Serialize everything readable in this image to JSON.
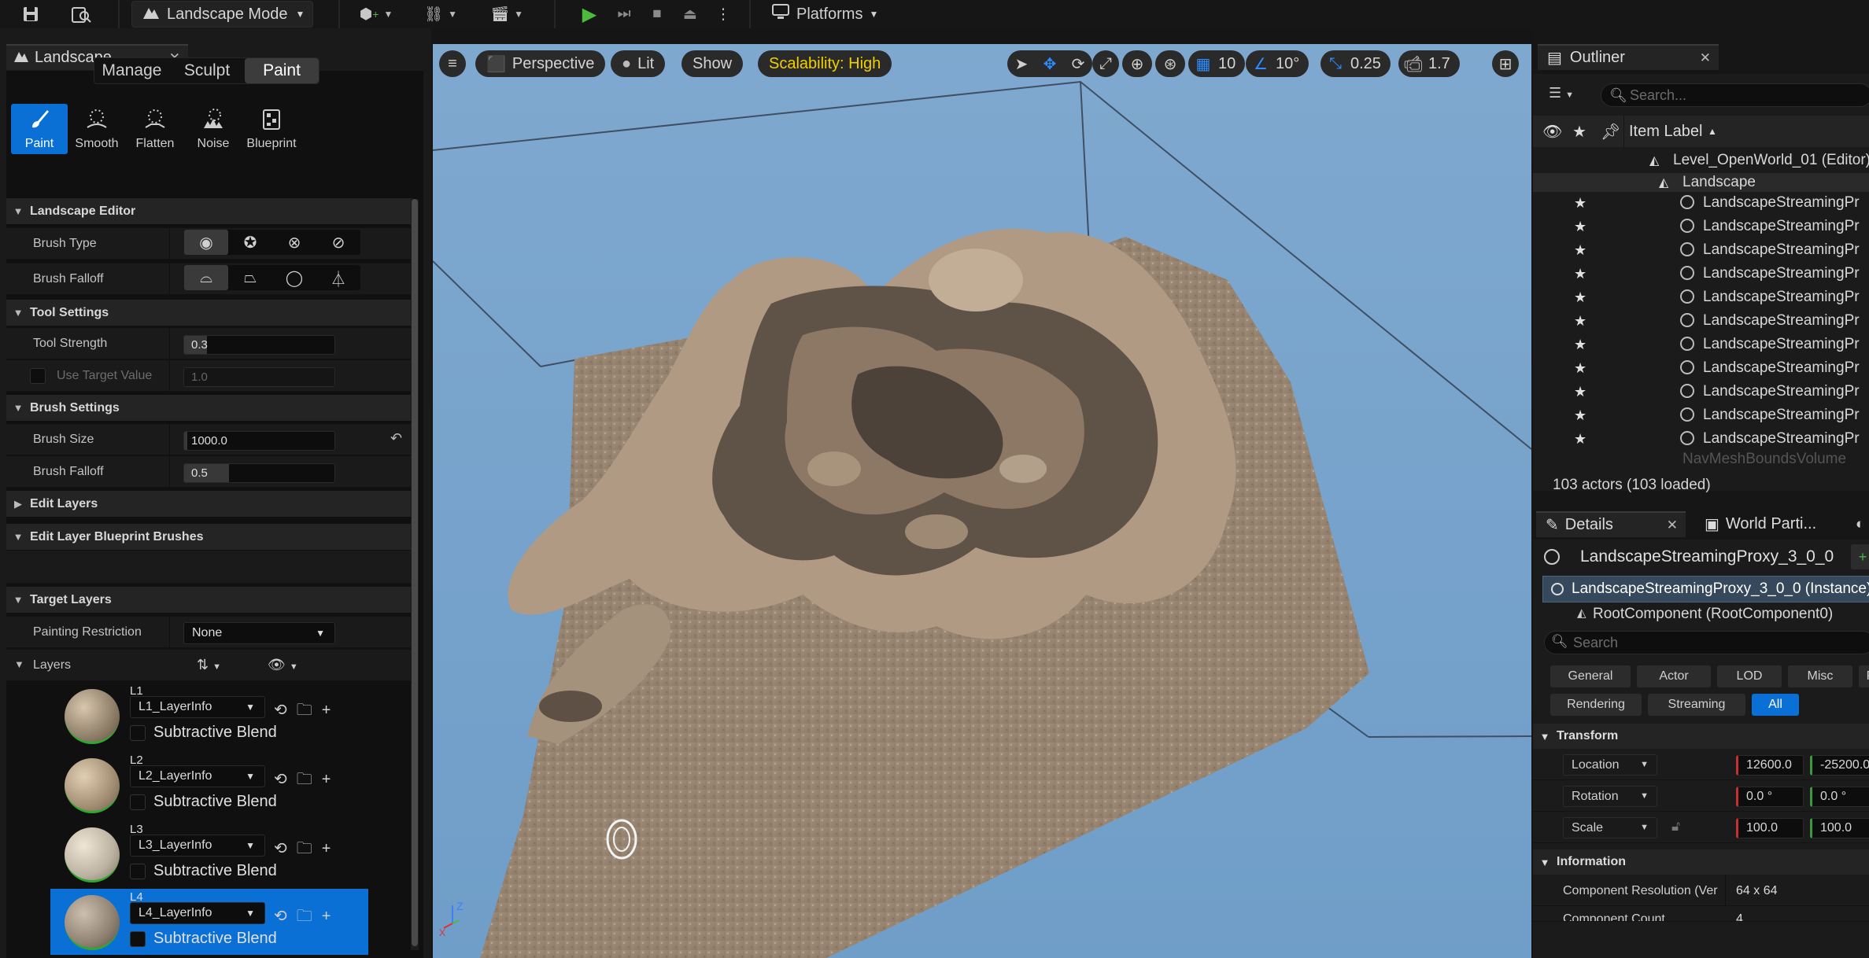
{
  "toolbar": {
    "mode_label": "Landscape Mode",
    "platforms_label": "Platforms"
  },
  "left_panel": {
    "tab_title": "Landscape",
    "mode_tabs": [
      "Manage",
      "Sculpt",
      "Paint"
    ],
    "active_mode": "Paint",
    "tools": [
      {
        "label": "Paint",
        "icon": "paint-brush-icon",
        "active": true
      },
      {
        "label": "Smooth",
        "icon": "smooth-icon",
        "active": false
      },
      {
        "label": "Flatten",
        "icon": "flatten-icon",
        "active": false
      },
      {
        "label": "Noise",
        "icon": "noise-icon",
        "active": false
      },
      {
        "label": "Blueprint",
        "icon": "blueprint-icon",
        "active": false
      }
    ],
    "sections": {
      "landscape_editor": "Landscape Editor",
      "tool_settings": "Tool Settings",
      "brush_settings": "Brush Settings",
      "edit_layers": "Edit Layers",
      "edit_layer_bp": "Edit Layer Blueprint Brushes",
      "target_layers": "Target Layers"
    },
    "brush_type_label": "Brush Type",
    "brush_falloff_type_label": "Brush Falloff",
    "tool_strength": {
      "label": "Tool Strength",
      "value": "0.3",
      "fraction": 0.15
    },
    "use_target_value": {
      "label": "Use Target Value",
      "value": "1.0"
    },
    "brush_size": {
      "label": "Brush Size",
      "value": "1000.0",
      "fraction": 0.02
    },
    "brush_falloff": {
      "label": "Brush Falloff",
      "value": "0.5",
      "fraction": 0.3
    },
    "painting_restriction": {
      "label": "Painting Restriction",
      "value": "None"
    },
    "layers_label": "Layers",
    "layers": [
      {
        "name": "L1",
        "info": "L1_LayerInfo",
        "subtractive": "Subtractive Blend",
        "selected": false
      },
      {
        "name": "L2",
        "info": "L2_LayerInfo",
        "subtractive": "Subtractive Blend",
        "selected": false
      },
      {
        "name": "L3",
        "info": "L3_LayerInfo",
        "subtractive": "Subtractive Blend",
        "selected": false
      },
      {
        "name": "L4",
        "info": "L4_LayerInfo",
        "subtractive": "Subtractive Blend",
        "selected": true
      }
    ]
  },
  "viewport": {
    "perspective_label": "Perspective",
    "lit_label": "Lit",
    "show_label": "Show",
    "scalability_label": "Scalability: High",
    "grid_snap": "10",
    "rotation_snap": "10°",
    "scale_snap": "0.25",
    "camera_speed": "1.7",
    "sky_color": "#7ba6ce"
  },
  "outliner": {
    "tab_title": "Outliner",
    "search_placeholder": "Search...",
    "column_header": "Item Label",
    "root_item": "Level_OpenWorld_01 (Editor)",
    "landscape_item": "Landscape",
    "proxy_items": [
      "LandscapeStreamingPr",
      "LandscapeStreamingPr",
      "LandscapeStreamingPr",
      "LandscapeStreamingPr",
      "LandscapeStreamingPr",
      "LandscapeStreamingPr",
      "LandscapeStreamingPr",
      "LandscapeStreamingPr",
      "LandscapeStreamingPr",
      "LandscapeStreamingPr",
      "LandscapeStreamingPr"
    ],
    "partial_item": "NavMeshBoundsVolume",
    "status": "103 actors (103 loaded)"
  },
  "details": {
    "tab_title": "Details",
    "world_tab_title": "World Parti...",
    "object_name": "LandscapeStreamingProxy_3_0_0",
    "instance_label": "LandscapeStreamingProxy_3_0_0 (Instance)",
    "root_component_label": "RootComponent (RootComponent0)",
    "search_placeholder": "Search",
    "categories_row1": [
      "General",
      "Actor",
      "LOD",
      "Misc",
      "P"
    ],
    "categories_row2": [
      "Rendering",
      "Streaming",
      "All"
    ],
    "active_category": "All",
    "transform_section": "Transform",
    "location": {
      "label": "Location",
      "x": "12600.0",
      "y": "-25200.0"
    },
    "rotation": {
      "label": "Rotation",
      "x": "0.0 °",
      "y": "0.0 °"
    },
    "scale": {
      "label": "Scale",
      "x": "100.0",
      "y": "100.0"
    },
    "information_section": "Information",
    "component_resolution": {
      "label": "Component Resolution (Ver",
      "value": "64 x 64"
    },
    "component_count": {
      "label": "Component Count",
      "value": "4"
    }
  }
}
